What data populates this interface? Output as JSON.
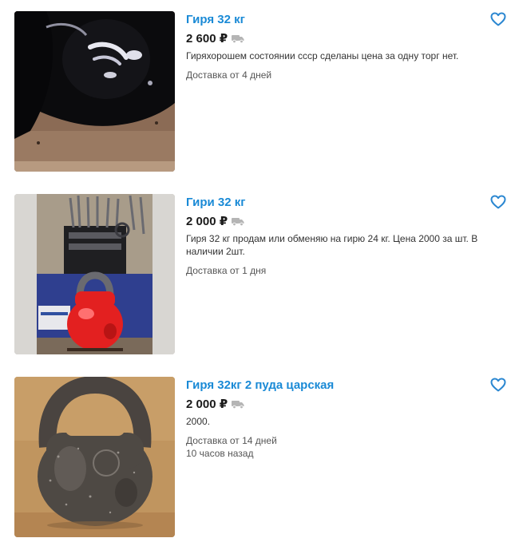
{
  "colors": {
    "title": "#1a8ad6",
    "favorite_icon": "#2b87d1",
    "price": "#1a1a1a",
    "delivery_icon": "#b5b5b5"
  },
  "listings": [
    {
      "title": "Гиря 32 кг",
      "price": "2 600 ₽",
      "description": "Гиряхорошем состоянии ссср сделаны цена за одну торг нет.",
      "delivery": "Доставка от 4 дней",
      "posted": ""
    },
    {
      "title": "Гири 32 кг",
      "price": "2 000 ₽",
      "description": "Гиря 32 кг продам или обменяю на гирю 24 кг. Цена 2000 за шт. В наличии 2шт.",
      "delivery": "Доставка от 1 дня",
      "posted": ""
    },
    {
      "title": "Гиря 32кг 2 пуда царская",
      "price": "2 000 ₽",
      "description": "2000.",
      "delivery": "Доставка от 14 дней",
      "posted": "10 часов назад"
    }
  ]
}
